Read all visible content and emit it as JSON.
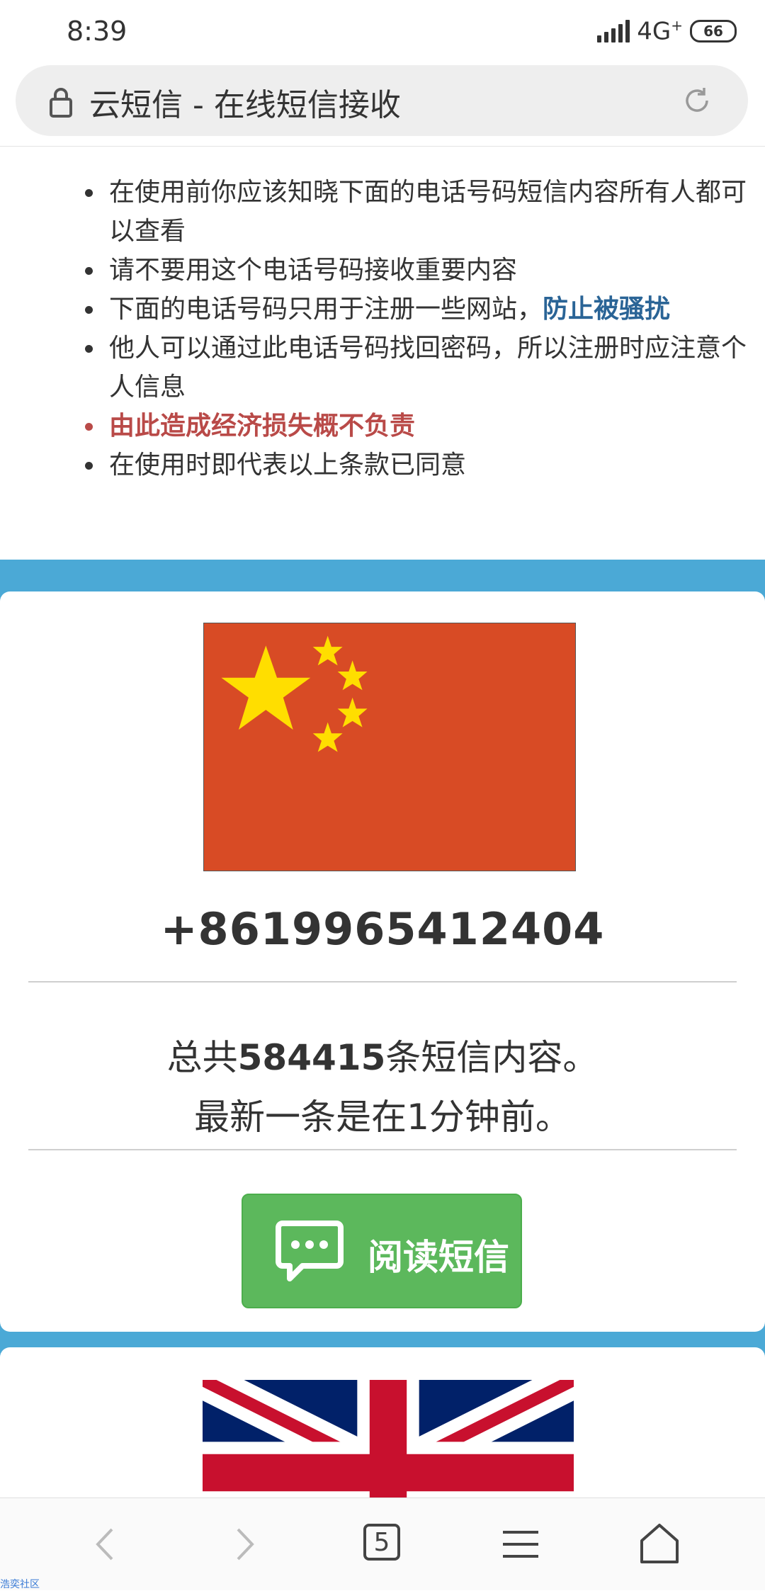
{
  "status_bar": {
    "time": "8:39",
    "network": "4G",
    "network_sup": "+",
    "battery": "66"
  },
  "url_bar": {
    "title": "云短信 - 在线短信接收"
  },
  "notices": {
    "item1": "在使用前你应该知晓下面的电话号码短信内容所有人都可以查看",
    "item2": "请不要用这个电话号码接收重要内容",
    "item3_prefix": "下面的电话号码只用于注册一些网站，",
    "item3_highlight": "防止被骚扰",
    "item4": "他人可以通过此电话号码找回密码，所以注册时应注意个人信息",
    "item5": "由此造成经济损失概不负责",
    "item6": "在使用时即代表以上条款已同意"
  },
  "card1": {
    "phone": "+8619965412404",
    "total_prefix": "总共",
    "total_count": "584415",
    "total_suffix": "条短信内容。",
    "latest": "最新一条是在1分钟前。",
    "read_button": "阅读短信"
  },
  "nav": {
    "tabs_count": "5"
  },
  "watermark": "浩奕社区",
  "colors": {
    "accent_blue": "#4ba9d6",
    "button_green": "#5cb85c",
    "warn_red": "#b94a48",
    "link_blue": "#2a6496",
    "flag_red": "#d84b25",
    "star_yellow": "#ffde00"
  }
}
